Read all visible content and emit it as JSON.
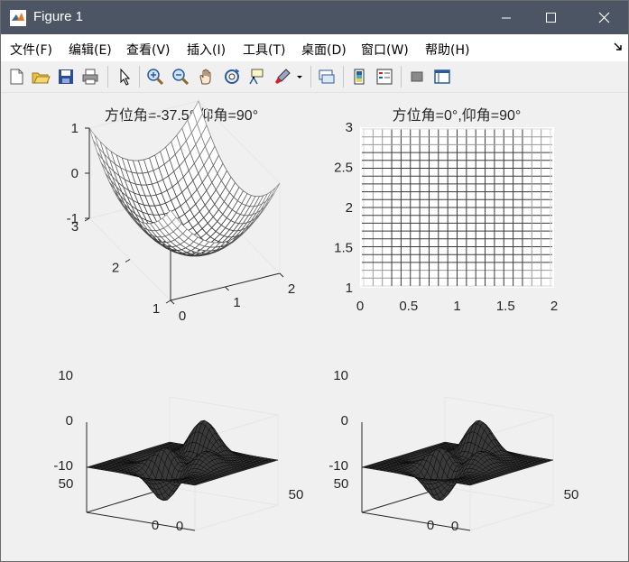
{
  "window": {
    "title": "Figure 1"
  },
  "menu": {
    "items": [
      "文件(F)",
      "编辑(E)",
      "查看(V)",
      "插入(I)",
      "工具(T)",
      "桌面(D)",
      "窗口(W)",
      "帮助(H)"
    ]
  },
  "toolbar": {
    "icons": [
      "new-figure-icon",
      "open-file-icon",
      "save-icon",
      "print-icon",
      "edit-plot-pointer-icon",
      "zoom-in-icon",
      "zoom-out-icon",
      "pan-hand-icon",
      "rotate-3d-icon",
      "data-cursor-icon",
      "brush-icon",
      "brush-dropdown-icon",
      "link-plot-icon",
      "insert-colorbar-icon",
      "insert-legend-icon",
      "hide-plot-tools-icon",
      "show-plot-tools-icon"
    ]
  },
  "colors": {
    "titlebar": "#4c5563",
    "menubar": "#ffffff",
    "figure_bg": "#f0f0f0"
  },
  "chart_data": [
    {
      "type": "3d-mesh",
      "title": "方位角=-37.5°,仰角=90°",
      "function": "z = (x-1)^2 + (y-2)^2 - 1",
      "x_ticks": [
        "0",
        "1",
        "2"
      ],
      "y_ticks": [
        "1",
        "2",
        "3"
      ],
      "z_ticks": [
        "-1",
        "0",
        "1"
      ],
      "xlim": [
        0,
        2
      ],
      "ylim": [
        1,
        3
      ],
      "zlim": [
        -1,
        1
      ],
      "grid": "off"
    },
    {
      "type": "mesh-2d-top-view",
      "title": "方位角=0°,仰角=90°",
      "x_ticks": [
        "0",
        "0.5",
        "1",
        "1.5",
        "2"
      ],
      "y_ticks": [
        "1",
        "1.5",
        "2",
        "2.5",
        "3"
      ],
      "xlim": [
        0,
        2
      ],
      "ylim": [
        1,
        3
      ]
    },
    {
      "type": "3d-surface",
      "title": "",
      "function": "peaks",
      "x_ticks": [
        "0",
        "50"
      ],
      "y_ticks": [
        "0",
        "50"
      ],
      "z_ticks": [
        "-10",
        "0",
        "10"
      ],
      "xlim": [
        0,
        50
      ],
      "ylim": [
        0,
        50
      ],
      "zlim": [
        -10,
        10
      ]
    },
    {
      "type": "3d-surface",
      "title": "",
      "function": "peaks",
      "x_ticks": [
        "0",
        "50"
      ],
      "y_ticks": [
        "0",
        "50"
      ],
      "z_ticks": [
        "-10",
        "0",
        "10"
      ],
      "xlim": [
        0,
        50
      ],
      "ylim": [
        0,
        50
      ],
      "zlim": [
        -10,
        10
      ]
    }
  ]
}
